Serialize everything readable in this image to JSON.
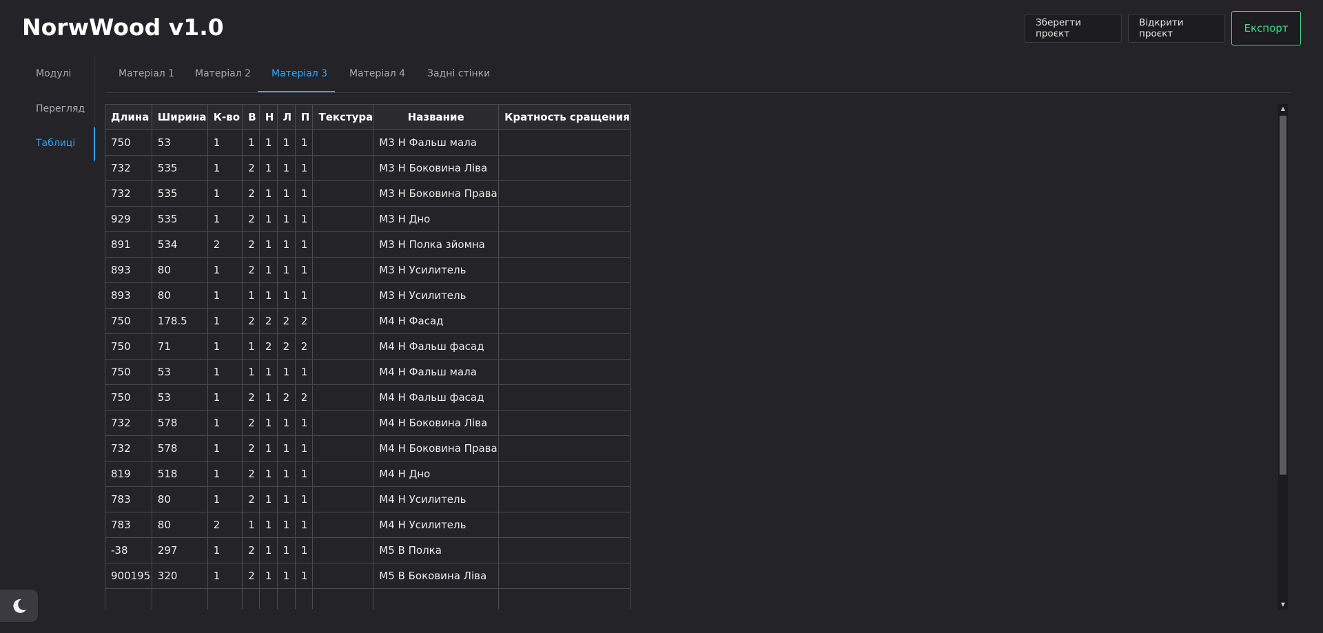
{
  "app": {
    "title": "NorwWood v1.0"
  },
  "header": {
    "save_label": "Зберегти проєкт",
    "open_label": "Відкрити проєкт",
    "export_label": "Експорт"
  },
  "sidebar": {
    "items": [
      {
        "label": "Модулі"
      },
      {
        "label": "Перегляд"
      },
      {
        "label": "Таблиці",
        "active": true
      }
    ]
  },
  "tabs": [
    {
      "label": "Матеріал 1"
    },
    {
      "label": "Матеріал 2"
    },
    {
      "label": "Матеріал 3",
      "active": true
    },
    {
      "label": "Матеріал 4"
    },
    {
      "label": "Задні стінки"
    }
  ],
  "table": {
    "headers": [
      "Длина",
      "Ширина",
      "К-во",
      "В",
      "Н",
      "Л",
      "П",
      "Текстура",
      "Название",
      "Кратность сращения"
    ],
    "rows": [
      [
        "750",
        "53",
        "1",
        "1",
        "1",
        "1",
        "1",
        "",
        "М3 Н Фальш мала",
        ""
      ],
      [
        "732",
        "535",
        "1",
        "2",
        "1",
        "1",
        "1",
        "",
        "М3 Н Боковина Ліва",
        ""
      ],
      [
        "732",
        "535",
        "1",
        "2",
        "1",
        "1",
        "1",
        "",
        "М3 Н Боковина Права",
        ""
      ],
      [
        "929",
        "535",
        "1",
        "2",
        "1",
        "1",
        "1",
        "",
        "М3 Н Дно",
        ""
      ],
      [
        "891",
        "534",
        "2",
        "2",
        "1",
        "1",
        "1",
        "",
        "М3 Н Полка зйомна",
        ""
      ],
      [
        "893",
        "80",
        "1",
        "2",
        "1",
        "1",
        "1",
        "",
        "М3 Н Усилитель",
        ""
      ],
      [
        "893",
        "80",
        "1",
        "1",
        "1",
        "1",
        "1",
        "",
        "М3 Н Усилитель",
        ""
      ],
      [
        "750",
        "178.5",
        "1",
        "2",
        "2",
        "2",
        "2",
        "",
        "М4 Н Фасад",
        ""
      ],
      [
        "750",
        "71",
        "1",
        "1",
        "2",
        "2",
        "2",
        "",
        "М4 Н Фальш фасад",
        ""
      ],
      [
        "750",
        "53",
        "1",
        "1",
        "1",
        "1",
        "1",
        "",
        "М4 Н Фальш мала",
        ""
      ],
      [
        "750",
        "53",
        "1",
        "2",
        "1",
        "2",
        "2",
        "",
        "М4 Н Фальш фасад",
        ""
      ],
      [
        "732",
        "578",
        "1",
        "2",
        "1",
        "1",
        "1",
        "",
        "М4 Н Боковина Ліва",
        ""
      ],
      [
        "732",
        "578",
        "1",
        "2",
        "1",
        "1",
        "1",
        "",
        "М4 Н Боковина Права",
        ""
      ],
      [
        "819",
        "518",
        "1",
        "2",
        "1",
        "1",
        "1",
        "",
        "М4 Н Дно",
        ""
      ],
      [
        "783",
        "80",
        "1",
        "2",
        "1",
        "1",
        "1",
        "",
        "М4 Н Усилитель",
        ""
      ],
      [
        "783",
        "80",
        "2",
        "1",
        "1",
        "1",
        "1",
        "",
        "М4 Н Усилитель",
        ""
      ],
      [
        "-38",
        "297",
        "1",
        "2",
        "1",
        "1",
        "1",
        "",
        "М5 В Полка",
        ""
      ],
      [
        "900195",
        "320",
        "1",
        "2",
        "1",
        "1",
        "1",
        "",
        "М5 В Боковина Ліва",
        ""
      ],
      [
        "",
        "",
        "",
        "",
        "",
        "",
        "",
        "",
        "",
        ""
      ]
    ]
  },
  "icons": {
    "theme": "moon-icon",
    "scroll_up": "scroll-up-arrow-icon",
    "scroll_down": "scroll-down-arrow-icon"
  },
  "colors": {
    "accent": "#2ea6ff",
    "export": "#3ddc84",
    "background": "#232328"
  }
}
